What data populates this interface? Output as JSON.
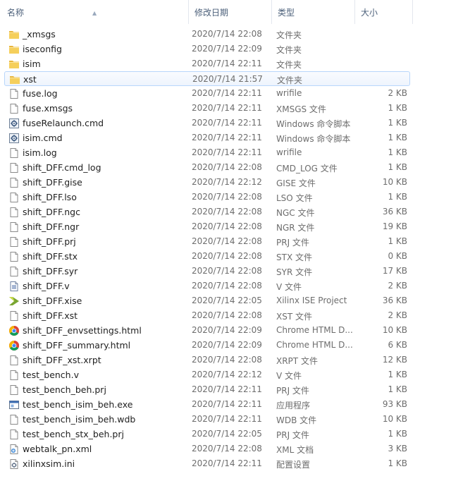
{
  "columns": {
    "name": "名称",
    "date": "修改日期",
    "type": "类型",
    "size": "大小"
  },
  "files": [
    {
      "name": "_xmsgs",
      "date": "2020/7/14 22:08",
      "type": "文件夹",
      "size": "",
      "icon": "folder-icon"
    },
    {
      "name": "iseconfig",
      "date": "2020/7/14 22:09",
      "type": "文件夹",
      "size": "",
      "icon": "folder-icon"
    },
    {
      "name": "isim",
      "date": "2020/7/14 22:11",
      "type": "文件夹",
      "size": "",
      "icon": "folder-icon"
    },
    {
      "name": "xst",
      "date": "2020/7/14 21:57",
      "type": "文件夹",
      "size": "",
      "icon": "folder-icon",
      "selected": true
    },
    {
      "name": "fuse.log",
      "date": "2020/7/14 22:11",
      "type": "wrifile",
      "size": "2 KB",
      "icon": "document-icon"
    },
    {
      "name": "fuse.xmsgs",
      "date": "2020/7/14 22:11",
      "type": "XMSGS 文件",
      "size": "1 KB",
      "icon": "document-icon"
    },
    {
      "name": "fuseRelaunch.cmd",
      "date": "2020/7/14 22:11",
      "type": "Windows 命令脚本",
      "size": "1 KB",
      "icon": "gear-script-icon"
    },
    {
      "name": "isim.cmd",
      "date": "2020/7/14 22:11",
      "type": "Windows 命令脚本",
      "size": "1 KB",
      "icon": "gear-script-icon"
    },
    {
      "name": "isim.log",
      "date": "2020/7/14 22:11",
      "type": "wrifile",
      "size": "1 KB",
      "icon": "document-icon"
    },
    {
      "name": "shift_DFF.cmd_log",
      "date": "2020/7/14 22:08",
      "type": "CMD_LOG 文件",
      "size": "1 KB",
      "icon": "document-icon"
    },
    {
      "name": "shift_DFF.gise",
      "date": "2020/7/14 22:12",
      "type": "GISE 文件",
      "size": "10 KB",
      "icon": "document-icon"
    },
    {
      "name": "shift_DFF.lso",
      "date": "2020/7/14 22:08",
      "type": "LSO 文件",
      "size": "1 KB",
      "icon": "document-icon"
    },
    {
      "name": "shift_DFF.ngc",
      "date": "2020/7/14 22:08",
      "type": "NGC 文件",
      "size": "36 KB",
      "icon": "document-icon"
    },
    {
      "name": "shift_DFF.ngr",
      "date": "2020/7/14 22:08",
      "type": "NGR 文件",
      "size": "19 KB",
      "icon": "document-icon"
    },
    {
      "name": "shift_DFF.prj",
      "date": "2020/7/14 22:08",
      "type": "PRJ 文件",
      "size": "1 KB",
      "icon": "document-icon"
    },
    {
      "name": "shift_DFF.stx",
      "date": "2020/7/14 22:08",
      "type": "STX 文件",
      "size": "0 KB",
      "icon": "document-icon"
    },
    {
      "name": "shift_DFF.syr",
      "date": "2020/7/14 22:08",
      "type": "SYR 文件",
      "size": "17 KB",
      "icon": "document-icon"
    },
    {
      "name": "shift_DFF.v",
      "date": "2020/7/14 22:08",
      "type": "V 文件",
      "size": "2 KB",
      "icon": "text-document-icon"
    },
    {
      "name": "shift_DFF.xise",
      "date": "2020/7/14 22:05",
      "type": "Xilinx ISE Project",
      "size": "36 KB",
      "icon": "xilinx-icon"
    },
    {
      "name": "shift_DFF.xst",
      "date": "2020/7/14 22:08",
      "type": "XST 文件",
      "size": "2 KB",
      "icon": "document-icon"
    },
    {
      "name": "shift_DFF_envsettings.html",
      "date": "2020/7/14 22:09",
      "type": "Chrome HTML D...",
      "size": "10 KB",
      "icon": "chrome-icon"
    },
    {
      "name": "shift_DFF_summary.html",
      "date": "2020/7/14 22:09",
      "type": "Chrome HTML D...",
      "size": "6 KB",
      "icon": "chrome-icon"
    },
    {
      "name": "shift_DFF_xst.xrpt",
      "date": "2020/7/14 22:08",
      "type": "XRPT 文件",
      "size": "12 KB",
      "icon": "document-icon"
    },
    {
      "name": "test_bench.v",
      "date": "2020/7/14 22:12",
      "type": "V 文件",
      "size": "1 KB",
      "icon": "document-icon"
    },
    {
      "name": "test_bench_beh.prj",
      "date": "2020/7/14 22:11",
      "type": "PRJ 文件",
      "size": "1 KB",
      "icon": "document-icon"
    },
    {
      "name": "test_bench_isim_beh.exe",
      "date": "2020/7/14 22:11",
      "type": "应用程序",
      "size": "93 KB",
      "icon": "exe-icon"
    },
    {
      "name": "test_bench_isim_beh.wdb",
      "date": "2020/7/14 22:11",
      "type": "WDB 文件",
      "size": "10 KB",
      "icon": "document-icon"
    },
    {
      "name": "test_bench_stx_beh.prj",
      "date": "2020/7/14 22:05",
      "type": "PRJ 文件",
      "size": "1 KB",
      "icon": "document-icon"
    },
    {
      "name": "webtalk_pn.xml",
      "date": "2020/7/14 22:08",
      "type": "XML 文档",
      "size": "3 KB",
      "icon": "xml-icon"
    },
    {
      "name": "xilinxsim.ini",
      "date": "2020/7/14 22:11",
      "type": "配置设置",
      "size": "1 KB",
      "icon": "settings-file-icon"
    }
  ]
}
